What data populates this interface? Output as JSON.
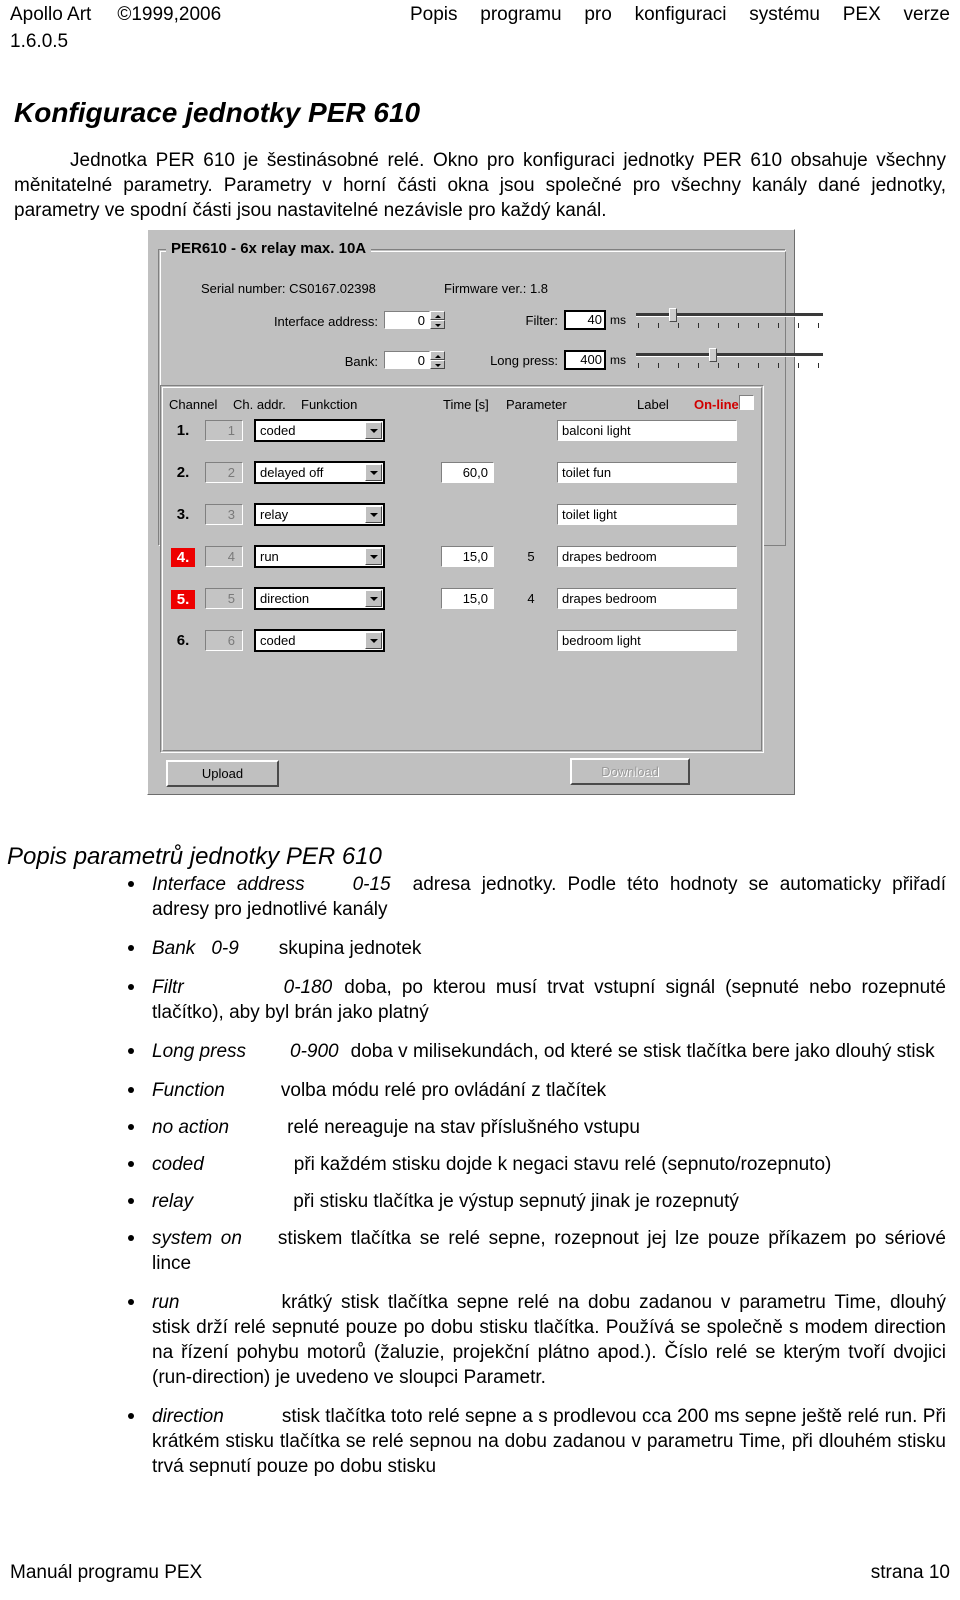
{
  "header": {
    "company": "Apollo Art",
    "copyright": "©1999,2006",
    "title_right": "Popis programu pro konfiguraci systému PEX verze",
    "version": "1.6.0.5"
  },
  "doc": {
    "title": "Konfigurace jednotky PER 610",
    "intro": "Jednotka PER 610 je šestinásobné relé. Okno pro konfiguraci jednotky PER 610 obsahuje všechny měnitatelné parametry. Parametry v horní části okna jsou společné pro všechny kanály dané jednotky, parametry ve spodní části jsou nastavitelné nezávisle pro každý kanál.",
    "section_title": "Popis parametrů jednotky PER 610"
  },
  "dialog": {
    "groupbox_title": "PER610 - 6x relay max. 10A",
    "serial_label": "Serial number:",
    "serial_value": "CS0167.02398",
    "firmware_label": "Firmware ver.:",
    "firmware_value": "1.8",
    "interface_address_label": "Interface address:",
    "interface_address_value": "0",
    "bank_label": "Bank:",
    "bank_value": "0",
    "filter_label": "Filter:",
    "filter_value": "40",
    "filter_unit": "ms",
    "long_press_label": "Long press:",
    "long_press_value": "400",
    "long_press_unit": "ms",
    "columns": {
      "channel": "Channel",
      "ch_addr": "Ch. addr.",
      "function": "Funkction",
      "time": "Time [s]",
      "parameter": "Parameter",
      "label": "Label",
      "online": "On-line"
    },
    "rows": [
      {
        "num": "1.",
        "alarm": false,
        "addr": "1",
        "function": "coded",
        "time": "",
        "param": "",
        "label": "balconi light"
      },
      {
        "num": "2.",
        "alarm": false,
        "addr": "2",
        "function": "delayed off",
        "time": "60,0",
        "param": "",
        "label": "toilet fun"
      },
      {
        "num": "3.",
        "alarm": false,
        "addr": "3",
        "function": "relay",
        "time": "",
        "param": "",
        "label": "toilet light"
      },
      {
        "num": "4.",
        "alarm": true,
        "addr": "4",
        "function": "run",
        "time": "15,0",
        "param": "5",
        "label": "drapes bedroom"
      },
      {
        "num": "5.",
        "alarm": true,
        "addr": "5",
        "function": "direction",
        "time": "15,0",
        "param": "4",
        "label": "drapes bedroom"
      },
      {
        "num": "6.",
        "alarm": false,
        "addr": "6",
        "function": "coded",
        "time": "",
        "param": "",
        "label": "bedroom light"
      }
    ],
    "upload_button": "Upload",
    "download_button": "Download",
    "accent_red": "#d00000",
    "alarm_red": "#ee0000",
    "face_gray": "#c0c0c0"
  },
  "params": [
    {
      "term": "Interface address",
      "range": "0-15",
      "desc": "adresa jednotky. Podle této hodnoty se automaticky přiřadí adresy pro jednotlivé kanály"
    },
    {
      "term": "Bank",
      "range": "0-9",
      "desc": "skupina jednotek"
    },
    {
      "term": "Filtr",
      "range": "0-180",
      "desc": "doba, po kterou musí trvat vstupní signál (sepnuté nebo rozepnuté tlačítko), aby byl brán jako platný"
    },
    {
      "term": "Long press",
      "range": "0-900",
      "desc": "doba v milisekundách, od které se stisk tlačítka bere jako dlouhý stisk"
    },
    {
      "term": "Function",
      "range": "",
      "desc": "volba módu relé pro ovládání z tlačítek"
    },
    {
      "term": "no action",
      "range": "",
      "desc": "relé nereaguje na stav příslušného vstupu"
    },
    {
      "term": "coded",
      "range": "",
      "desc": "při každém stisku dojde k negaci stavu relé (sepnuto/rozepnuto)"
    },
    {
      "term": "relay",
      "range": "",
      "desc": "při stisku tlačítka je výstup sepnutý jinak je rozepnutý"
    },
    {
      "term": "system on",
      "range": "",
      "desc": "stiskem tlačítka se relé sepne, rozepnout jej lze pouze příkazem po sériové lince"
    },
    {
      "term": "run",
      "range": "",
      "desc": "krátký stisk tlačítka sepne relé na dobu zadanou v parametru Time, dlouhý stisk drží relé sepnuté pouze po dobu stisku tlačítka. Používá se společně s modem direction na řízení pohybu motorů (žaluzie, projekční plátno apod.). Číslo relé se kterým tvoří dvojici (run-direction) je uvedeno ve sloupci Parametr."
    },
    {
      "term": "direction",
      "range": "",
      "desc": "stisk tlačítka toto relé sepne a s prodlevou cca 200 ms sepne ještě relé run. Při krátkém stisku tlačítka se relé sepnou na dobu zadanou v parametru Time, při dlouhém stisku trvá sepnutí pouze po dobu stisku"
    }
  ],
  "footer": {
    "left": "Manuál programu PEX",
    "right": "strana 10"
  }
}
